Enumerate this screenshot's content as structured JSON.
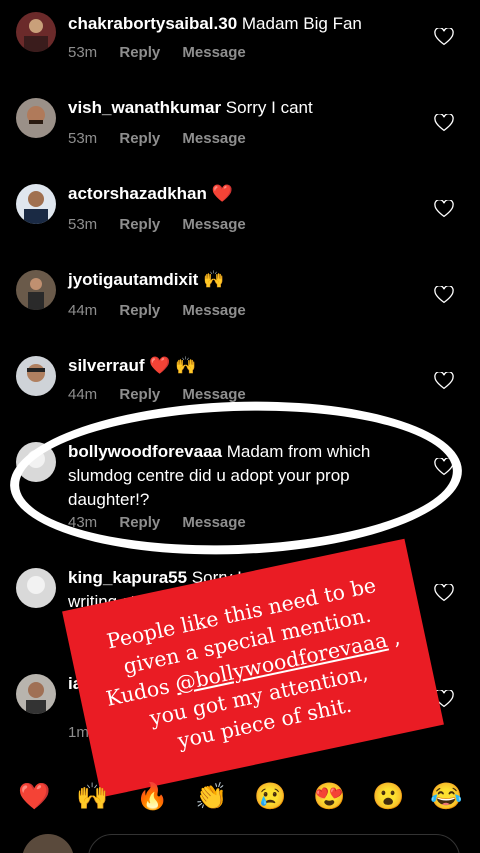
{
  "comments": [
    {
      "username": "chakrabortysaibal.30",
      "text": "Madam Big Fan",
      "time": "53m",
      "reply": "Reply",
      "message": "Message"
    },
    {
      "username": "vish_wanathkumar",
      "text": "Sorry I cant",
      "time": "53m",
      "reply": "Reply",
      "message": "Message"
    },
    {
      "username": "actorshazadkhan",
      "text": "❤️",
      "time": "53m",
      "reply": "Reply",
      "message": "Message"
    },
    {
      "username": "jyotigautamdixit",
      "text": "🙌",
      "time": "44m",
      "reply": "Reply",
      "message": "Message"
    },
    {
      "username": "silverrauf",
      "text": "❤️ 🙌",
      "time": "44m",
      "reply": "Reply",
      "message": "Message"
    },
    {
      "username": "bollywoodforevaaa",
      "text": "Madam from which slumdog centre did u adopt your prop daughter!?",
      "time": "43m",
      "reply": "Reply",
      "message": "Message"
    },
    {
      "username": "king_kapura55",
      "text": "Sorry I ... writing style",
      "time": "",
      "reply": "",
      "message": ""
    },
    {
      "username": "ia",
      "text": "wi",
      "time": "1m",
      "reply": "",
      "message": ""
    }
  ],
  "sticker": {
    "line1": "People like this need to be",
    "line2": "given a special mention.",
    "line3_prefix": "Kudos ",
    "line3_link": "@bollywoodforevaaa",
    "line3_suffix": " ,",
    "line4": "you got my attention,",
    "line5": "you piece of shit."
  },
  "reactions": [
    "❤️",
    "🙌",
    "🔥",
    "👏",
    "😢",
    "😍",
    "😮",
    "😂"
  ],
  "colors": {
    "background": "#000000",
    "meta_text": "#8e8e8e",
    "sticker_red": "#ea1c24"
  }
}
